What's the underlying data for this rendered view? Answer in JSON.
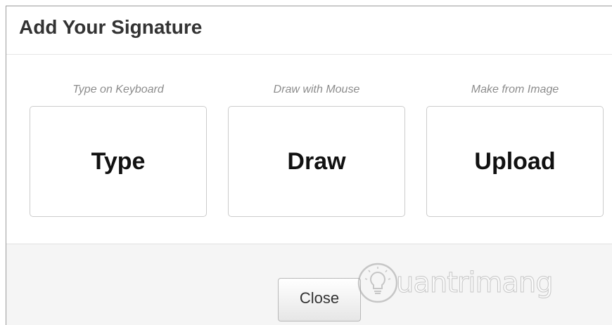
{
  "dialog": {
    "title": "Add Your Signature"
  },
  "options": [
    {
      "caption": "Type on Keyboard",
      "label": "Type"
    },
    {
      "caption": "Draw with Mouse",
      "label": "Draw"
    },
    {
      "caption": "Make from Image",
      "label": "Upload"
    }
  ],
  "footer": {
    "close_label": "Close"
  },
  "watermark": {
    "text": "uantrimang",
    "icon": "lightbulb-icon"
  }
}
